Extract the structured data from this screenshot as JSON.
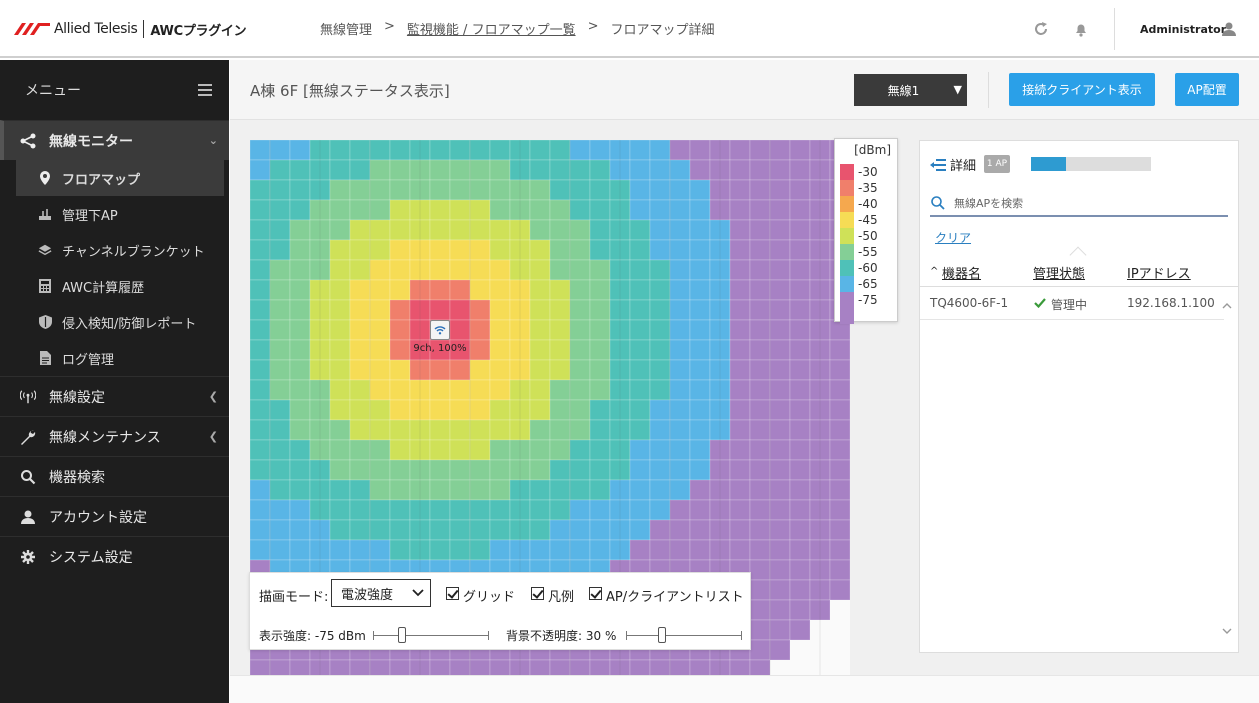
{
  "header": {
    "logo_text": "Allied Telesis",
    "plugin_name": "AWCプラグイン",
    "breadcrumb": [
      "無線管理",
      "監視機能 / フロアマップ一覧",
      "フロアマップ詳細"
    ],
    "crumb_sep": ">",
    "user": "Administrator"
  },
  "sidebar": {
    "menu_label": "メニュー",
    "sections": [
      {
        "label": "無線モニター",
        "icon": "share-icon",
        "expanded": true
      },
      {
        "label": "無線設定",
        "icon": "antenna-icon"
      },
      {
        "label": "無線メンテナンス",
        "icon": "wrench-icon"
      },
      {
        "label": "機器検索",
        "icon": "search-icon"
      },
      {
        "label": "アカウント設定",
        "icon": "user-icon"
      },
      {
        "label": "システム設定",
        "icon": "gear-icon"
      }
    ],
    "sub_items": [
      {
        "label": "フロアマップ",
        "icon": "map-pin-icon",
        "active": true
      },
      {
        "label": "管理下AP",
        "icon": "ap-icon"
      },
      {
        "label": "チャンネルブランケット",
        "icon": "layers-icon"
      },
      {
        "label": "AWC計算履歴",
        "icon": "calculator-icon"
      },
      {
        "label": "侵入検知/防御レポート",
        "icon": "shield-icon"
      },
      {
        "label": "ログ管理",
        "icon": "document-icon"
      }
    ]
  },
  "main": {
    "title": "A棟 6F [無線ステータス表示]",
    "band_select": "無線1",
    "show_clients_button": "接続クライアント表示",
    "ap_place_button": "AP配置"
  },
  "map": {
    "ap_label": "9ch, 100%",
    "legend": {
      "unit": "[dBm]",
      "items": [
        {
          "label": "-30",
          "color": "#e8546e"
        },
        {
          "label": "-35",
          "color": "#f07f6b"
        },
        {
          "label": "-40",
          "color": "#f5a84e"
        },
        {
          "label": "-45",
          "color": "#f6dc55"
        },
        {
          "label": "-50",
          "color": "#cfe158"
        },
        {
          "label": "-55",
          "color": "#84cf96"
        },
        {
          "label": "-60",
          "color": "#4fc1b8"
        },
        {
          "label": "-65",
          "color": "#59b5e6"
        },
        {
          "label": "-75",
          "color": "#a781c4"
        }
      ]
    },
    "zones": [
      "#e8546e",
      "#f07f6b",
      "#f6dc55",
      "#cfe158",
      "#84cf96",
      "#4fc1b8",
      "#59b5e6",
      "#a781c4"
    ]
  },
  "controls": {
    "draw_mode_label": "描画モード:",
    "draw_mode_value": "電波強度",
    "grid_label": "グリッド",
    "legend_label": "凡例",
    "list_label": "AP/クライアントリスト",
    "strength_label": "表示強度: -75 dBm",
    "strength_fraction": 0.23,
    "opacity_label": "背景不透明度: 30 %",
    "opacity_fraction": 0.3
  },
  "panel": {
    "title": "詳細",
    "ap_count": "1 AP",
    "progress_fraction": 0.29,
    "search_placeholder": "無線APを検索",
    "clear": "クリア",
    "columns": [
      "機器名",
      "管理状態",
      "IPアドレス"
    ],
    "sort_indicator": "^",
    "rows": [
      {
        "name": "TQ4600-6F-1",
        "status": "管理中",
        "ip": "192.168.1.100"
      }
    ]
  }
}
